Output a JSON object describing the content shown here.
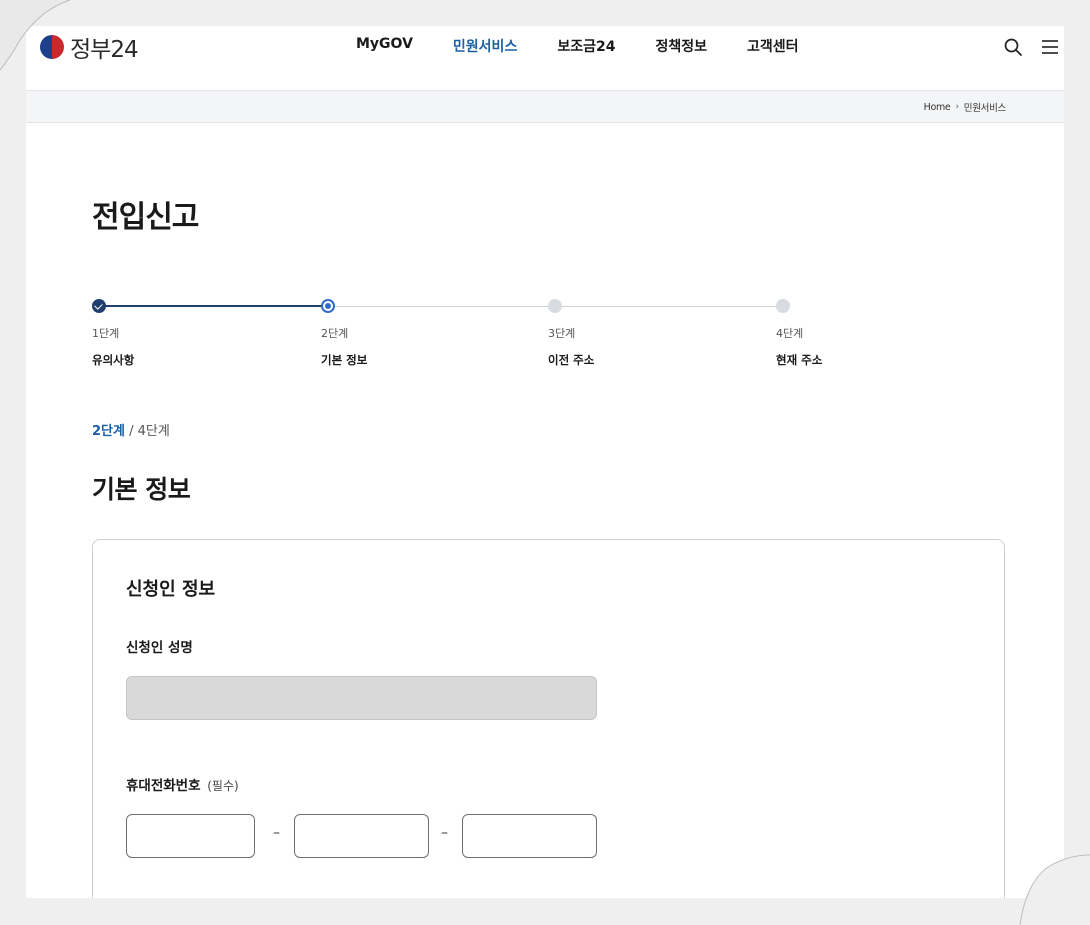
{
  "header": {
    "logo_text": "정부24",
    "nav": [
      "MyGOV",
      "민원서비스",
      "보조금24",
      "정책정보",
      "고객센터"
    ],
    "active_nav": "민원서비스",
    "accent": "#1a5fa8"
  },
  "breadcrumb": [
    "Home",
    "민원서비스"
  ],
  "page_title": "전입신고",
  "stepper": {
    "steps": [
      {
        "num": "1단계",
        "name": "유의사항",
        "state": "done"
      },
      {
        "num": "2단계",
        "name": "기본 정보",
        "state": "current"
      },
      {
        "num": "3단계",
        "name": "이전 주소",
        "state": "todo"
      },
      {
        "num": "4단계",
        "name": "현재 주소",
        "state": "todo"
      }
    ]
  },
  "progress": {
    "current": "2단계",
    "separator": " / ",
    "total": "4단계"
  },
  "section_title": "기본 정보",
  "card": {
    "title": "신청인 정보",
    "name_label": "신청인 성명",
    "name_value": "",
    "phone_label": "휴대전화번호",
    "phone_required": "(필수)",
    "phone_separator": "–",
    "phone_parts": [
      "",
      "",
      ""
    ]
  }
}
